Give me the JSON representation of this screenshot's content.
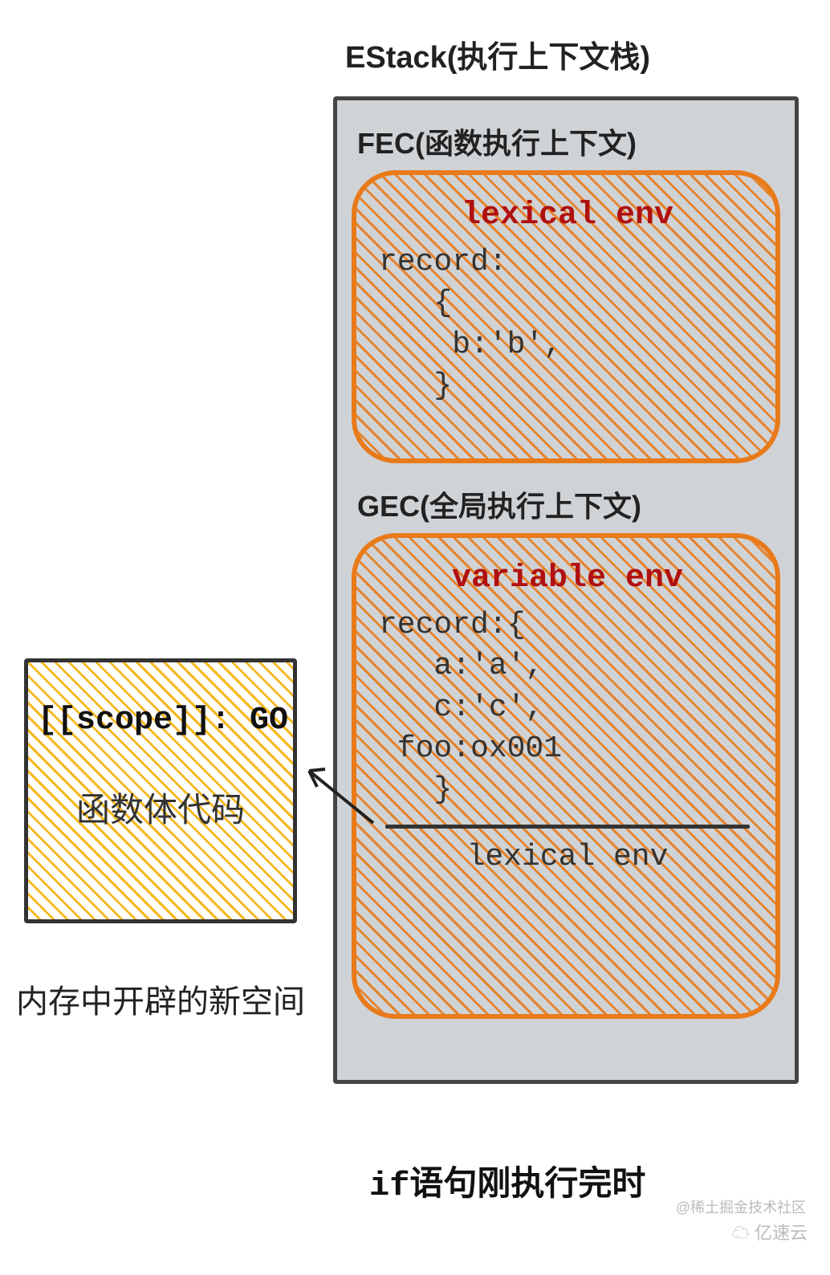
{
  "title": "EStack(执行上下文栈)",
  "fec": {
    "title": "FEC(函数执行上下文)",
    "env_label": "lexical env",
    "record": "record:\n   {\n    b:'b',\n   }"
  },
  "gec": {
    "title": "GEC(全局执行上下文)",
    "env_label": "variable env",
    "record": "record:{\n   a:'a',\n   c:'c',\n foo:ox001\n   }",
    "lexical_bottom": "lexical env"
  },
  "scope": {
    "line": "[[scope]]: GO",
    "body": "函数体代码"
  },
  "memory_label": "内存中开辟的新空间",
  "bottom_caption_if": "if",
  "bottom_caption_rest": "语句刚执行完时",
  "watermark1": "@稀土掘金技术社区",
  "watermark2": "☁ 亿速云"
}
